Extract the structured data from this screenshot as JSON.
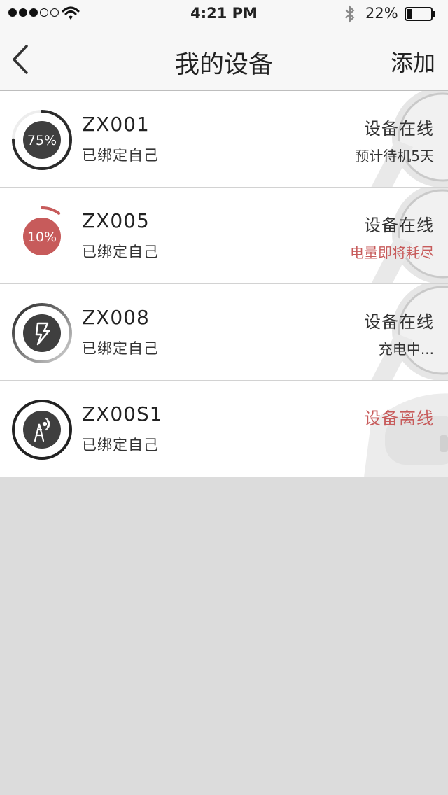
{
  "status_bar": {
    "time": "4:21 PM",
    "battery_percent": "22%",
    "battery_level": 0.22,
    "signal_bars_filled": 3,
    "signal_bars_total": 5,
    "icons": [
      "wifi-icon",
      "bluetooth-icon",
      "battery-icon"
    ]
  },
  "nav": {
    "title": "我的设备",
    "add_label": "添加",
    "back_icon": "chevron-left-icon"
  },
  "colors": {
    "accent_red": "#c75b5b",
    "dark": "#3f3f3f",
    "ring_dark": "#222222"
  },
  "devices": [
    {
      "name": "ZX001",
      "binding": "已绑定自己",
      "status": "设备在线",
      "detail": "预计待机5天",
      "battery_label": "75%",
      "battery_level": 0.75,
      "icon": "battery-75-icon"
    },
    {
      "name": "ZX005",
      "binding": "已绑定自己",
      "status": "设备在线",
      "detail": "电量即将耗尽",
      "battery_label": "10%",
      "battery_level": 0.1,
      "icon": "battery-low-icon"
    },
    {
      "name": "ZX008",
      "binding": "已绑定自己",
      "status": "设备在线",
      "detail": "充电中...",
      "icon": "charging-icon"
    },
    {
      "name": "ZX00S1",
      "binding": "已绑定自己",
      "status": "设备离线",
      "icon": "signal-tower-icon"
    }
  ]
}
